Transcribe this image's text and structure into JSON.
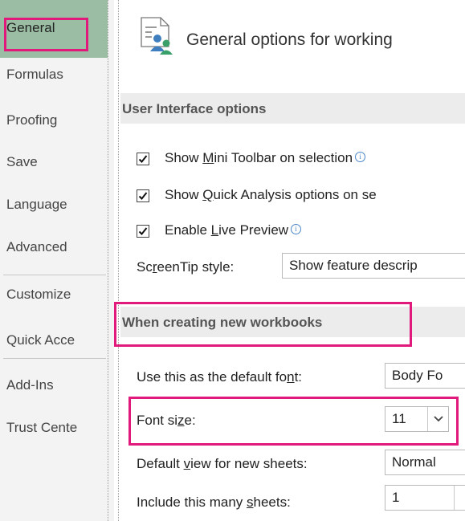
{
  "sidebar": {
    "items": [
      {
        "label": "General",
        "selected": true
      },
      {
        "label": "Formulas"
      },
      {
        "label": "Proofing"
      },
      {
        "label": "Save"
      },
      {
        "label": "Language"
      },
      {
        "label": "Advanced"
      },
      {
        "label": "Customize"
      },
      {
        "label": "Quick Acce"
      },
      {
        "label": "Add-Ins"
      },
      {
        "label": "Trust Cente"
      }
    ]
  },
  "header": {
    "title": "General options for working",
    "icon": "general-options-icon"
  },
  "ui_options": {
    "section_title": "User Interface options",
    "mini_toolbar": {
      "pre": "Show ",
      "u": "M",
      "post": "ini Toolbar on selection",
      "checked": true
    },
    "quick_analysis": {
      "pre": "Show ",
      "u": "Q",
      "post": "uick Analysis options on se",
      "checked": true
    },
    "live_preview": {
      "pre": "Enable ",
      "u": "L",
      "post": "ive Preview",
      "checked": true
    },
    "screentip": {
      "pre": "Sc",
      "u": "r",
      "post": "eenTip style:",
      "value": "Show feature descrip"
    },
    "info_glyph": "i"
  },
  "new_workbooks": {
    "section_title": "When creating new workbooks",
    "default_font": {
      "pre": "Use this as the default fo",
      "u": "n",
      "post": "t:",
      "value": "Body Fo"
    },
    "font_size": {
      "pre": "Font si",
      "u": "z",
      "post": "e:",
      "value": "11"
    },
    "default_view": {
      "pre": "Default ",
      "u": "v",
      "post": "iew for new sheets:",
      "value": "Normal"
    },
    "sheets": {
      "pre": "Include this many ",
      "u": "s",
      "post": "heets:",
      "value": "1"
    }
  },
  "colors": {
    "highlight": "#e0197a",
    "selected_nav": "#9bbda3"
  }
}
